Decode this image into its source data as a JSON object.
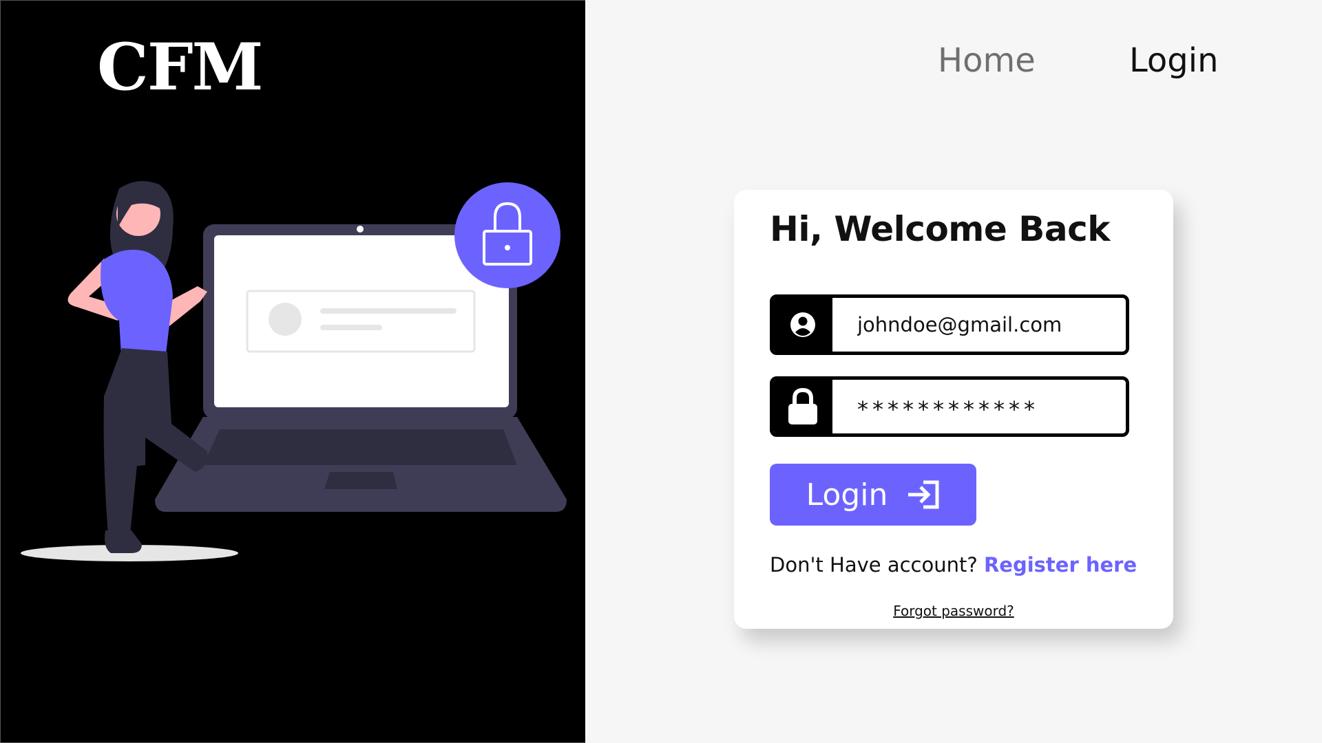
{
  "brand": {
    "logo_text": "CFM"
  },
  "nav": {
    "home_label": "Home",
    "login_label": "Login"
  },
  "login_card": {
    "title": "Hi, Welcome Back",
    "email_value": "johndoe@gmail.com",
    "password_mask": "************",
    "login_button_label": "Login",
    "register_prompt": "Don't Have account?",
    "register_link_label": "Register here",
    "forgot_password_label": "Forgot password?"
  },
  "icons": {
    "email_field_icon": "user-circle-icon",
    "password_field_icon": "lock-icon",
    "login_button_icon": "sign-in-icon",
    "illustration_lock": "padlock-icon"
  },
  "colors": {
    "accent": "#6c63ff",
    "left_panel_bg": "#000000",
    "right_panel_bg": "#f6f6f6",
    "card_bg": "#ffffff",
    "skin": "#ffb6b6",
    "laptop": "#3f3d56",
    "figure_dark": "#2f2e41"
  }
}
